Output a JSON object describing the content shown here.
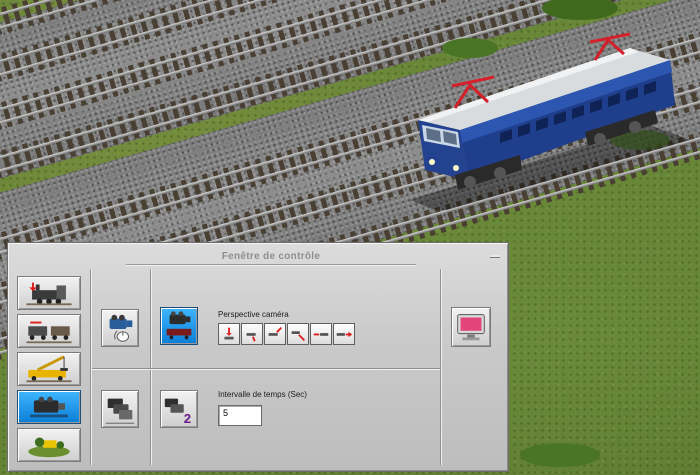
{
  "control_window": {
    "title": "Fenêtre de contrôle",
    "camera_perspective_label": "Perspective caméra",
    "time_interval_label": "Intervalle de temps (Sec)",
    "time_interval_value": "5"
  },
  "icons": {
    "mode_buttons": [
      "locomotive-icon",
      "wagons-icon",
      "crane-wagon-icon",
      "camera-wagon-icon",
      "landscape-icon"
    ],
    "active_mode": "camera-wagon-icon",
    "camera_directions": [
      "front",
      "front-right",
      "side-right",
      "rear-right",
      "rear",
      "rear-left"
    ]
  },
  "colors": {
    "active_blue": "#0a7ed6",
    "arrow_red": "#e01a1a",
    "locomotive_blue": "#1f3e8c"
  }
}
